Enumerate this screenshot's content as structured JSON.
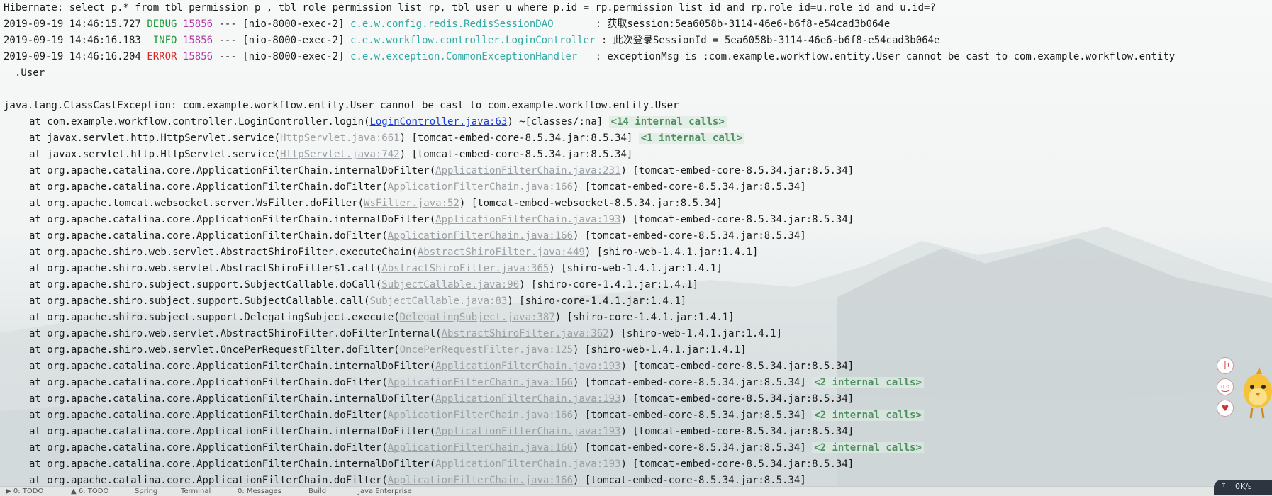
{
  "log": {
    "hibernate": "Hibernate: select p.* from tbl_permission p , tbl_role_permission_list rp, tbl_user u where p.id = rp.permission_list_id and rp.role_id=u.role_id and u.id=?",
    "entries": [
      {
        "datetime": "2019-09-19 14:46:15.727",
        "level": "DEBUG",
        "pid": "15856",
        "sep": "---",
        "thread": "[nio-8000-exec-2]",
        "logger": "c.e.w.config.redis.RedisSessionDAO",
        "msg": ": 获取session:5ea6058b-3114-46e6-b6f8-e54cad3b064e"
      },
      {
        "datetime": "2019-09-19 14:46:16.183",
        "level": "INFO",
        "pid": "15856",
        "sep": "---",
        "thread": "[nio-8000-exec-2]",
        "logger": "c.e.w.workflow.controller.LoginController",
        "msg": ": 此次登录SessionId = 5ea6058b-3114-46e6-b6f8-e54cad3b064e"
      },
      {
        "datetime": "2019-09-19 14:46:16.204",
        "level": "ERROR",
        "pid": "15856",
        "sep": "---",
        "thread": "[nio-8000-exec-2]",
        "logger": "c.e.w.exception.CommonExceptionHandler",
        "msg": ": exceptionMsg is :com.example.workflow.entity.User cannot be cast to com.example.workflow.entity",
        "msg_cont": ".User"
      }
    ],
    "exception": "java.lang.ClassCastException: com.example.workflow.entity.User cannot be cast to com.example.workflow.entity.User",
    "frames": [
      {
        "method": "at com.example.workflow.controller.LoginController.login(",
        "link": "LoginController.java:63",
        "link_type": "src",
        "after": ") ~[classes/:na] ",
        "fold": "<14 internal calls>"
      },
      {
        "method": "at javax.servlet.http.HttpServlet.service(",
        "link": "HttpServlet.java:661",
        "link_type": "lib",
        "after": ") [tomcat-embed-core-8.5.34.jar:8.5.34] ",
        "fold": "<1 internal call>"
      },
      {
        "method": "at javax.servlet.http.HttpServlet.service(",
        "link": "HttpServlet.java:742",
        "link_type": "lib",
        "after": ") [tomcat-embed-core-8.5.34.jar:8.5.34]",
        "fold": ""
      },
      {
        "method": "at org.apache.catalina.core.ApplicationFilterChain.internalDoFilter(",
        "link": "ApplicationFilterChain.java:231",
        "link_type": "lib",
        "after": ") [tomcat-embed-core-8.5.34.jar:8.5.34]",
        "fold": ""
      },
      {
        "method": "at org.apache.catalina.core.ApplicationFilterChain.doFilter(",
        "link": "ApplicationFilterChain.java:166",
        "link_type": "lib",
        "after": ") [tomcat-embed-core-8.5.34.jar:8.5.34]",
        "fold": ""
      },
      {
        "method": "at org.apache.tomcat.websocket.server.WsFilter.doFilter(",
        "link": "WsFilter.java:52",
        "link_type": "lib",
        "after": ") [tomcat-embed-websocket-8.5.34.jar:8.5.34]",
        "fold": ""
      },
      {
        "method": "at org.apache.catalina.core.ApplicationFilterChain.internalDoFilter(",
        "link": "ApplicationFilterChain.java:193",
        "link_type": "lib",
        "after": ") [tomcat-embed-core-8.5.34.jar:8.5.34]",
        "fold": ""
      },
      {
        "method": "at org.apache.catalina.core.ApplicationFilterChain.doFilter(",
        "link": "ApplicationFilterChain.java:166",
        "link_type": "lib",
        "after": ") [tomcat-embed-core-8.5.34.jar:8.5.34]",
        "fold": ""
      },
      {
        "method": "at org.apache.shiro.web.servlet.AbstractShiroFilter.executeChain(",
        "link": "AbstractShiroFilter.java:449",
        "link_type": "lib",
        "after": ") [shiro-web-1.4.1.jar:1.4.1]",
        "fold": ""
      },
      {
        "method": "at org.apache.shiro.web.servlet.AbstractShiroFilter$1.call(",
        "link": "AbstractShiroFilter.java:365",
        "link_type": "lib",
        "after": ") [shiro-web-1.4.1.jar:1.4.1]",
        "fold": ""
      },
      {
        "method": "at org.apache.shiro.subject.support.SubjectCallable.doCall(",
        "link": "SubjectCallable.java:90",
        "link_type": "lib",
        "after": ") [shiro-core-1.4.1.jar:1.4.1]",
        "fold": ""
      },
      {
        "method": "at org.apache.shiro.subject.support.SubjectCallable.call(",
        "link": "SubjectCallable.java:83",
        "link_type": "lib",
        "after": ") [shiro-core-1.4.1.jar:1.4.1]",
        "fold": ""
      },
      {
        "method": "at org.apache.shiro.subject.support.DelegatingSubject.execute(",
        "link": "DelegatingSubject.java:387",
        "link_type": "lib",
        "after": ") [shiro-core-1.4.1.jar:1.4.1]",
        "fold": ""
      },
      {
        "method": "at org.apache.shiro.web.servlet.AbstractShiroFilter.doFilterInternal(",
        "link": "AbstractShiroFilter.java:362",
        "link_type": "lib",
        "after": ") [shiro-web-1.4.1.jar:1.4.1]",
        "fold": ""
      },
      {
        "method": "at org.apache.shiro.web.servlet.OncePerRequestFilter.doFilter(",
        "link": "OncePerRequestFilter.java:125",
        "link_type": "lib",
        "after": ") [shiro-web-1.4.1.jar:1.4.1]",
        "fold": ""
      },
      {
        "method": "at org.apache.catalina.core.ApplicationFilterChain.internalDoFilter(",
        "link": "ApplicationFilterChain.java:193",
        "link_type": "lib",
        "after": ") [tomcat-embed-core-8.5.34.jar:8.5.34]",
        "fold": ""
      },
      {
        "method": "at org.apache.catalina.core.ApplicationFilterChain.doFilter(",
        "link": "ApplicationFilterChain.java:166",
        "link_type": "lib",
        "after": ") [tomcat-embed-core-8.5.34.jar:8.5.34] ",
        "fold": "<2 internal calls>"
      },
      {
        "method": "at org.apache.catalina.core.ApplicationFilterChain.internalDoFilter(",
        "link": "ApplicationFilterChain.java:193",
        "link_type": "lib",
        "after": ") [tomcat-embed-core-8.5.34.jar:8.5.34]",
        "fold": ""
      },
      {
        "method": "at org.apache.catalina.core.ApplicationFilterChain.doFilter(",
        "link": "ApplicationFilterChain.java:166",
        "link_type": "lib",
        "after": ") [tomcat-embed-core-8.5.34.jar:8.5.34] ",
        "fold": "<2 internal calls>"
      },
      {
        "method": "at org.apache.catalina.core.ApplicationFilterChain.internalDoFilter(",
        "link": "ApplicationFilterChain.java:193",
        "link_type": "lib",
        "after": ") [tomcat-embed-core-8.5.34.jar:8.5.34]",
        "fold": ""
      },
      {
        "method": "at org.apache.catalina.core.ApplicationFilterChain.doFilter(",
        "link": "ApplicationFilterChain.java:166",
        "link_type": "lib",
        "after": ") [tomcat-embed-core-8.5.34.jar:8.5.34] ",
        "fold": "<2 internal calls>"
      },
      {
        "method": "at org.apache.catalina.core.ApplicationFilterChain.internalDoFilter(",
        "link": "ApplicationFilterChain.java:193",
        "link_type": "lib",
        "after": ") [tomcat-embed-core-8.5.34.jar:8.5.34]",
        "fold": ""
      },
      {
        "method": "at org.apache.catalina.core.ApplicationFilterChain.doFilter(",
        "link": "ApplicationFilterChain.java:166",
        "link_type": "lib",
        "after": ") [tomcat-embed-core-8.5.34.jar:8.5.34]",
        "fold": ""
      }
    ]
  },
  "side_tools": {
    "lang": "中",
    "emoji": "◦͜◦",
    "skin": "♥"
  },
  "statusbar": {
    "items": [
      "▶ 0: TODO",
      "▲ 6: TODO",
      "Spring",
      "Terminal",
      "0: Messages",
      "Build",
      "Java Enterprise"
    ]
  },
  "net_widget": {
    "arrow": "↑",
    "speed": "0K/s"
  },
  "icons": {
    "mascot": "chick-mascot-icon",
    "net": "arrow-up-icon",
    "lang": "chinese-input-icon"
  },
  "colors": {
    "debug": "#1a9a38",
    "info": "#1a9a38",
    "error": "#d42a2a",
    "pid": "#b23aa8",
    "logger": "#31a9a3",
    "src_link": "#1a3fd4",
    "lib_link": "#9aa0a3",
    "fold": "#4f8f62"
  }
}
